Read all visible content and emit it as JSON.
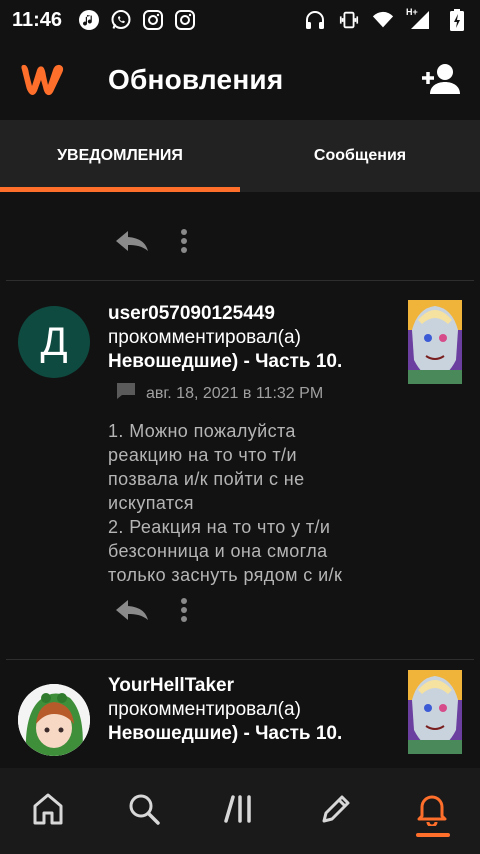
{
  "status_bar": {
    "time": "11:46",
    "icons_left": [
      "music-icon",
      "whatsapp-icon",
      "instagram-icon",
      "instagram-icon"
    ],
    "icons_right": [
      "headphones-icon",
      "vibrate-icon",
      "wifi-icon",
      "signal-icon",
      "battery-icon"
    ],
    "network_type": "H+"
  },
  "header": {
    "title": "Обновления",
    "brand_color": "#ff6f2c"
  },
  "tabs": [
    {
      "label": "УВЕДОМЛЕНИЯ",
      "active": true
    },
    {
      "label": "Сообщения",
      "active": false
    }
  ],
  "notifications": [
    {
      "username": "user057090125449",
      "avatar_letter": "Д",
      "action": "прокомментировал(а)",
      "story": "Невошедшие) - Часть 10.",
      "date": "авг. 18, 2021 в 11:32 PM",
      "comment_lines": [
        "1. Можно пожалуйста",
        "реакцию на то что т/и",
        "позвала и/к пойти с не",
        "искупатся",
        "2. Реакция на то что у т/и",
        "безсонница и она смогла",
        "только заснуть рядом с и/к"
      ]
    },
    {
      "username": "YourHellTaker",
      "action": "прокомментировал(а)",
      "story": "Невошедшие) - Часть 10."
    }
  ],
  "bottom_nav": [
    {
      "icon": "home-icon",
      "active": false
    },
    {
      "icon": "search-icon",
      "active": false
    },
    {
      "icon": "library-icon",
      "active": false
    },
    {
      "icon": "write-icon",
      "active": false
    },
    {
      "icon": "bell-icon",
      "active": true
    }
  ]
}
